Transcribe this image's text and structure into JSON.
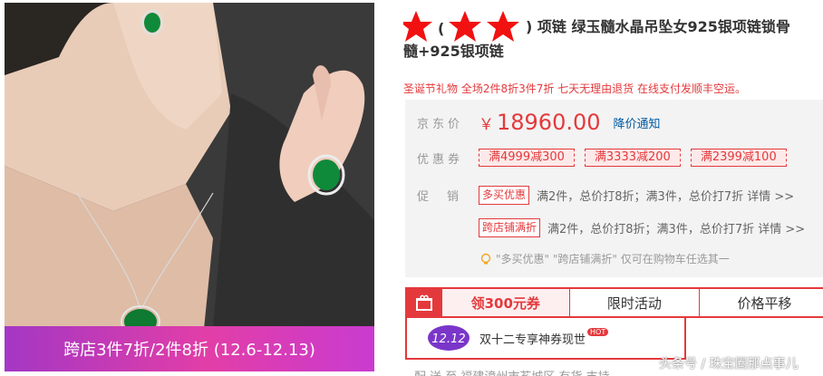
{
  "product_image": {
    "promo_text": "跨店3件7折/2件8折 (12.6-12.13)"
  },
  "product": {
    "title_line1_tail": ") 项链 绿玉髓水晶吊坠女925银项链锁骨",
    "title_line1_open": "(",
    "title_line2": "髓+925银项链",
    "slogan": "圣诞节礼物 全场2件8折3件7折 七天无理由退货 在线支付发顺丰空运。"
  },
  "price": {
    "label": "京东价",
    "currency": "￥",
    "value": "18960.00",
    "notify": "降价通知"
  },
  "coupons": {
    "label": "优惠券",
    "items": [
      "满4999减300",
      "满3333减200",
      "满2399减100"
    ]
  },
  "promotion": {
    "label": "促销",
    "items": [
      {
        "tag": "多买优惠",
        "text": "满2件，总价打8折；满3件，总价打7折 详情 >>"
      },
      {
        "tag": "跨店铺满折",
        "text": "满2件，总价打8折；满3件，总价打7折 详情 >>"
      }
    ],
    "tip": "\"多买优惠\" \"跨店铺满折\" 仅可在购物车任选其一"
  },
  "tabs": {
    "items": [
      "领300元券",
      "限时活动",
      "价格平移"
    ]
  },
  "banner": {
    "badge": "12.12",
    "text": "双十二专享神券现世",
    "hot": "HOT"
  },
  "bottom_row": {
    "text": "配 送 至    福建漳州市芗城区    有货    支持"
  },
  "watermark": "头条号 / 珠宝圈那点事儿",
  "colors": {
    "accent": "#e4393c",
    "promo_purple": "#b03ac6",
    "link_blue": "#005aa0"
  }
}
